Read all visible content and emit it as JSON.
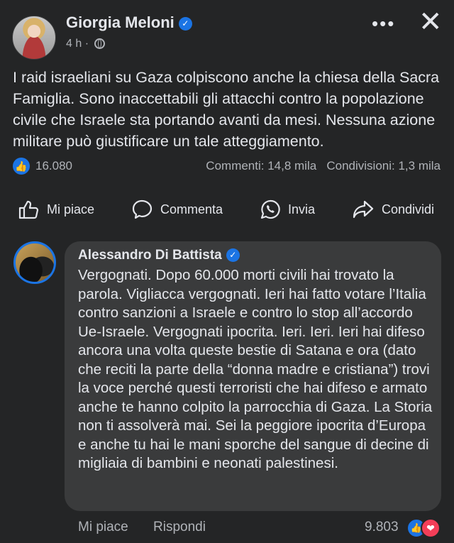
{
  "post": {
    "author": "Giorgia Meloni",
    "time": "4 h ·",
    "text": "I raid israeliani su Gaza colpiscono anche la chiesa della Sacra Famiglia. Sono inaccettabili gli attacchi contro la popolazione civile che Israele sta portando avanti da mesi. Nessuna azione militare può giustificare un tale atteggiamento.",
    "likes": "16.080",
    "comments": "Commenti: 14,8 mila",
    "shares": "Condivisioni: 1,3 mila"
  },
  "actions": {
    "like": "Mi piace",
    "comment": "Commenta",
    "send": "Invia",
    "share": "Condividi"
  },
  "comment": {
    "author": "Alessandro Di Battista",
    "text": "Vergognati. Dopo 60.000 morti civili hai trovato la parola. Vigliacca vergognati. Ieri hai fatto votare l’Italia contro sanzioni a Israele e contro lo stop all’accordo Ue-Israele. Vergognati ipocrita. Ieri. Ieri. Ieri hai difeso ancora una volta queste bestie di Satana e ora (dato che reciti la parte della “donna madre e cristiana”) trovi la voce perché questi terroristi che hai difeso e armato anche te hanno colpito la parrocchia di Gaza. La Storia non ti assolverà mai. Sei la peggiore ipocrita d’Europa e anche tu hai le mani sporche del sangue di decine di migliaia di bambini e neonati palestinesi.",
    "like_label": "Mi piace",
    "reply_label": "Rispondi",
    "reactions": "9.803"
  },
  "icons": {
    "verified": "verified-badge-icon",
    "globe": "globe-icon",
    "more": "more-icon",
    "close": "close-icon"
  },
  "colors": {
    "accent": "#1b74e4",
    "love": "#f33e58",
    "background": "#242526",
    "bubble": "#3a3b3c"
  }
}
